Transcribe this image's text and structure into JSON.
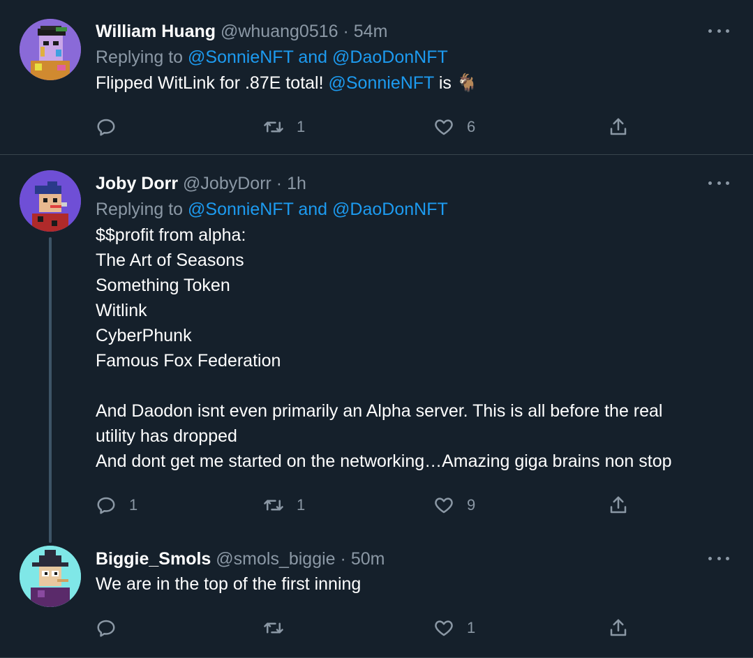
{
  "tweets": [
    {
      "name": "William Huang",
      "handle": "@whuang0516",
      "dot": "·",
      "time": "54m",
      "replying_prefix": "Replying to",
      "replying_to_1": "@SonnieNFT",
      "replying_and": "and",
      "replying_to_2": "@DaoDonNFT",
      "text_before": "Flipped WitLink for .87E total!",
      "text_mention": "@SonnieNFT",
      "text_after": "is 🐐",
      "replies": "",
      "retweets": "1",
      "likes": "6"
    },
    {
      "name": "Joby Dorr",
      "handle": "@JobyDorr",
      "dot": "·",
      "time": "1h",
      "replying_prefix": "Replying to",
      "replying_to_1": "@SonnieNFT",
      "replying_and": "and",
      "replying_to_2": "@DaoDonNFT",
      "text": "$$profit from alpha:\nThe Art of Seasons\nSomething Token\nWitlink\nCyberPhunk\nFamous Fox Federation\n\nAnd Daodon isnt even primarily an Alpha server. This is all before the real\nutility has dropped\nAnd dont get me started on the networking…Amazing giga brains non stop",
      "replies": "1",
      "retweets": "1",
      "likes": "9"
    },
    {
      "name": "Biggie_Smols",
      "handle": "@smols_biggie",
      "dot": "·",
      "time": "50m",
      "text": "We are in the top of the first inning",
      "replies": "",
      "retweets": "",
      "likes": "1"
    }
  ],
  "colors": {
    "background": "#15202b",
    "secondary_text": "#8b98a5",
    "link": "#1d9bf0",
    "divider": "#38444d"
  },
  "icons": [
    "reply-icon",
    "retweet-icon",
    "like-icon",
    "share-icon",
    "more-icon"
  ]
}
